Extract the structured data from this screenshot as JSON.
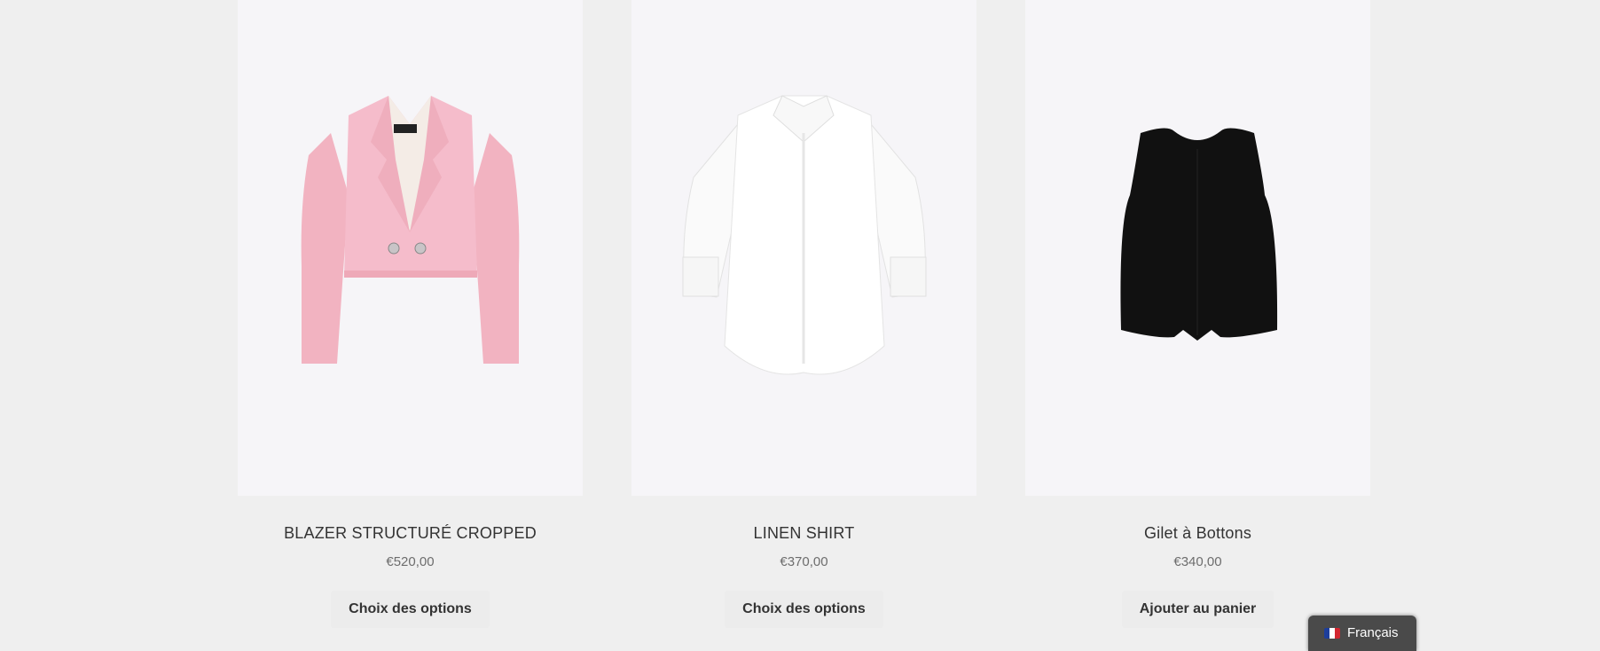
{
  "products": [
    {
      "name": "BLAZER STRUCTURÉ CROPPED",
      "price": "€520,00",
      "button_label": "Choix des options",
      "image_icon": "pink-blazer-image"
    },
    {
      "name": "LINEN SHIRT",
      "price": "€370,00",
      "button_label": "Choix des options",
      "image_icon": "white-shirt-image"
    },
    {
      "name": "Gilet à Bottons",
      "price": "€340,00",
      "button_label": "Ajouter au panier",
      "image_icon": "black-vest-image"
    }
  ],
  "language_switcher": {
    "label": "Français",
    "flag_icon": "france-flag-icon",
    "flag_colors": [
      "#1d3e9b",
      "#ffffff",
      "#d22630"
    ]
  },
  "colors": {
    "page_background": "#efefef",
    "image_background": "#f6f5f8",
    "button_background": "#ececec",
    "blazer_pink": "#f2b6c4",
    "vest_black": "#111111"
  }
}
